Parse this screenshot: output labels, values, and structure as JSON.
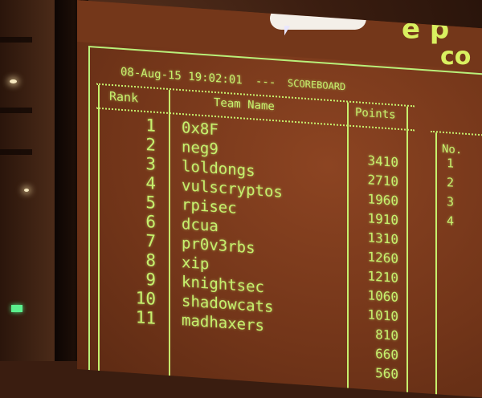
{
  "screen": {
    "heading_line1": "e p",
    "heading_line2": "co"
  },
  "scoreboard": {
    "timestamp": "08-Aug-15 19:02:01",
    "title_sep": "---",
    "title": "SCOREBOARD",
    "columns": {
      "rank": "Rank",
      "team": "Team Name",
      "points": "Points",
      "no": "No."
    },
    "rows": [
      {
        "rank": "1",
        "team": "0x8F",
        "points": ""
      },
      {
        "rank": "2",
        "team": "neg9",
        "points": "3410"
      },
      {
        "rank": "3",
        "team": "loldongs",
        "points": "2710"
      },
      {
        "rank": "4",
        "team": "vulscryptos",
        "points": "1960"
      },
      {
        "rank": "5",
        "team": "rpisec",
        "points": "1910"
      },
      {
        "rank": "6",
        "team": "dcua",
        "points": "1310"
      },
      {
        "rank": "7",
        "team": "pr0v3rbs",
        "points": "1260"
      },
      {
        "rank": "8",
        "team": "xip",
        "points": "1210"
      },
      {
        "rank": "9",
        "team": "knightsec",
        "points": "1060"
      },
      {
        "rank": "10",
        "team": "shadowcats",
        "points": "1010"
      },
      {
        "rank": "11",
        "team": "madhaxers",
        "points": "810"
      }
    ],
    "extra_points": [
      "660",
      "560"
    ],
    "side_numbers": [
      "1",
      "2",
      "3",
      "4"
    ]
  },
  "colors": {
    "text": "#c6f06d",
    "screen": "#7a3a1c",
    "exit_sign": "#5cf08e"
  }
}
